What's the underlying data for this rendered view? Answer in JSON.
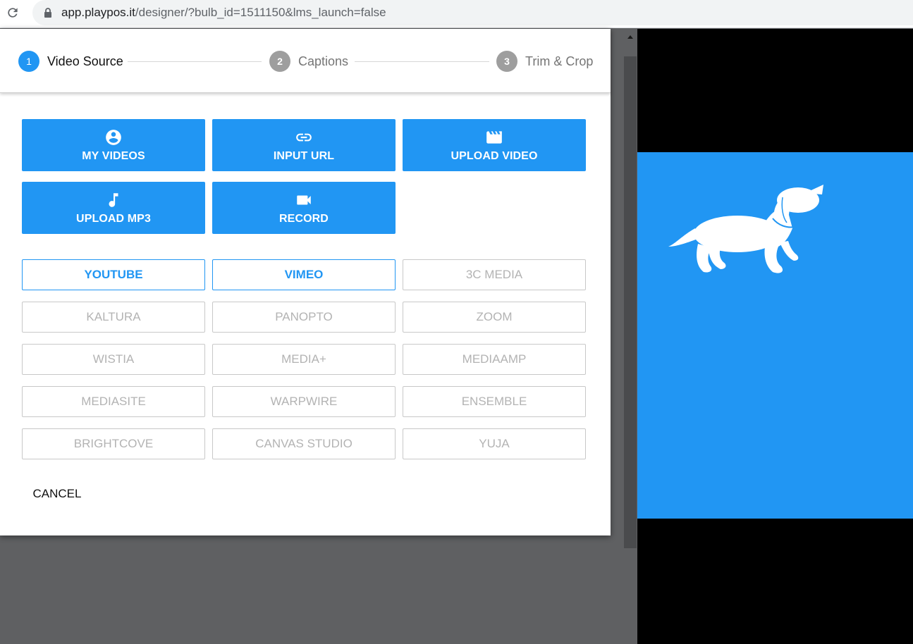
{
  "browser": {
    "url_host": "app.playpos.it",
    "url_rest": "/designer/?bulb_id=1511150&lms_launch=false",
    "icons": {
      "reload": "reload-icon",
      "lock": "lock-icon"
    }
  },
  "stepper": {
    "steps": [
      {
        "num": "1",
        "label": "Video Source",
        "state": "active"
      },
      {
        "num": "2",
        "label": "Captions",
        "state": "inactive"
      },
      {
        "num": "3",
        "label": "Trim & Crop",
        "state": "inactive"
      }
    ]
  },
  "actions": [
    {
      "label": "MY VIDEOS",
      "icon": "account-circle-icon"
    },
    {
      "label": "INPUT URL",
      "icon": "link-icon"
    },
    {
      "label": "UPLOAD VIDEO",
      "icon": "movie-clapper-icon"
    },
    {
      "label": "UPLOAD MP3",
      "icon": "music-note-icon"
    },
    {
      "label": "RECORD",
      "icon": "videocam-icon"
    }
  ],
  "providers": [
    {
      "label": "YOUTUBE",
      "enabled": true
    },
    {
      "label": "VIMEO",
      "enabled": true
    },
    {
      "label": "3C MEDIA",
      "enabled": false
    },
    {
      "label": "KALTURA",
      "enabled": false
    },
    {
      "label": "PANOPTO",
      "enabled": false
    },
    {
      "label": "ZOOM",
      "enabled": false
    },
    {
      "label": "WISTIA",
      "enabled": false
    },
    {
      "label": "MEDIA+",
      "enabled": false
    },
    {
      "label": "MEDIAAMP",
      "enabled": false
    },
    {
      "label": "MEDIASITE",
      "enabled": false
    },
    {
      "label": "WARPWIRE",
      "enabled": false
    },
    {
      "label": "ENSEMBLE",
      "enabled": false
    },
    {
      "label": "BRIGHTCOVE",
      "enabled": false
    },
    {
      "label": "CANVAS STUDIO",
      "enabled": false
    },
    {
      "label": "YUJA",
      "enabled": false
    }
  ],
  "cancel_label": "CANCEL",
  "colors": {
    "accent": "#2196f3",
    "backdrop": "#5f6062",
    "disabled_text": "#b3b3b3"
  },
  "preview": {
    "logo": "dachshund-logo"
  }
}
